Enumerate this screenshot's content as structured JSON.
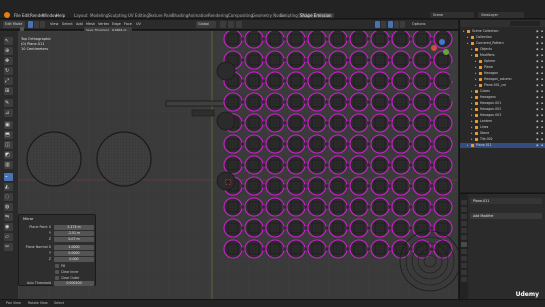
{
  "app": {
    "menu": [
      "File",
      "Edit",
      "Render",
      "Window",
      "Help"
    ],
    "workspaces": [
      "Layout",
      "Modeling",
      "Sculpting",
      "UV Editing",
      "Texture Paint",
      "Shading",
      "Animation",
      "Rendering",
      "Compositing",
      "Geometry Nodes",
      "Scripting",
      "Shape Emission"
    ],
    "active_workspace": "Shape Emission",
    "scene_label": "Scene",
    "view_layer_label": "ViewLayer",
    "accent_color": "#4772b3",
    "logo_color": "#e87d0d"
  },
  "header": {
    "edit_mode": "Edit Mode",
    "mode_buttons": [
      "Vertex",
      "Edge",
      "Face"
    ],
    "menus": [
      "View",
      "Select",
      "Add",
      "Mesh",
      "Vertex",
      "Edge",
      "Face",
      "UV"
    ],
    "pivot": "Global",
    "select_label": "Options",
    "snapping_label": "Save Threshold",
    "snapping_value": "0.0001 m"
  },
  "viewport": {
    "info_line1": "Top Orthographic",
    "info_line2": "(0) Plane.011",
    "info_line3": "10 Centimeters",
    "options_label": "Options"
  },
  "redo_panel": {
    "title": "Mirror",
    "fields": [
      {
        "label": "Plane Point X",
        "value": "2.274 m"
      },
      {
        "label": "Y",
        "value": "-2.51 m"
      },
      {
        "label": "Z",
        "value": "0.07 m"
      },
      {
        "label": "Plane Normal X",
        "value": "1.0000"
      },
      {
        "label": "Y",
        "value": "0.0000"
      },
      {
        "label": "Z",
        "value": "0.000"
      }
    ],
    "checks": [
      "Fill",
      "Clear Inner",
      "Clear Outer"
    ],
    "axis_threshold_label": "Axis Threshold",
    "axis_threshold_value": "0.000100"
  },
  "outliner": {
    "header": "Scene Collection",
    "rows": [
      {
        "label": "Scene Collection",
        "indent": 0
      },
      {
        "label": "Collection",
        "indent": 1
      },
      {
        "label": "Cornered_Pattern",
        "indent": 1
      },
      {
        "label": "Objects",
        "indent": 2
      },
      {
        "label": "Modifiers",
        "indent": 2
      },
      {
        "label": "Sphere",
        "indent": 3
      },
      {
        "label": "Plane",
        "indent": 3
      },
      {
        "label": "Hexagon",
        "indent": 3
      },
      {
        "label": "Hexagon_column",
        "indent": 3
      },
      {
        "label": "Plane.001_col",
        "indent": 3
      },
      {
        "label": "Cubes",
        "indent": 2
      },
      {
        "label": "Hexagons",
        "indent": 2
      },
      {
        "label": "Hexagon.001",
        "indent": 2
      },
      {
        "label": "Hexagon.002",
        "indent": 2
      },
      {
        "label": "Hexagon.003",
        "indent": 2
      },
      {
        "label": "Lantern",
        "indent": 2
      },
      {
        "label": "Lines",
        "indent": 2
      },
      {
        "label": "Stone",
        "indent": 2
      },
      {
        "label": "Tile.002",
        "indent": 2
      },
      {
        "label": "Plane.011",
        "indent": 1,
        "selected": true
      }
    ]
  },
  "properties": {
    "object_name": "Plane.011",
    "add_modifier": "Add Modifier"
  },
  "statusbar": {
    "items": [
      "Pan View",
      "Rotate View",
      "Select"
    ]
  },
  "watermark": "Udemy"
}
